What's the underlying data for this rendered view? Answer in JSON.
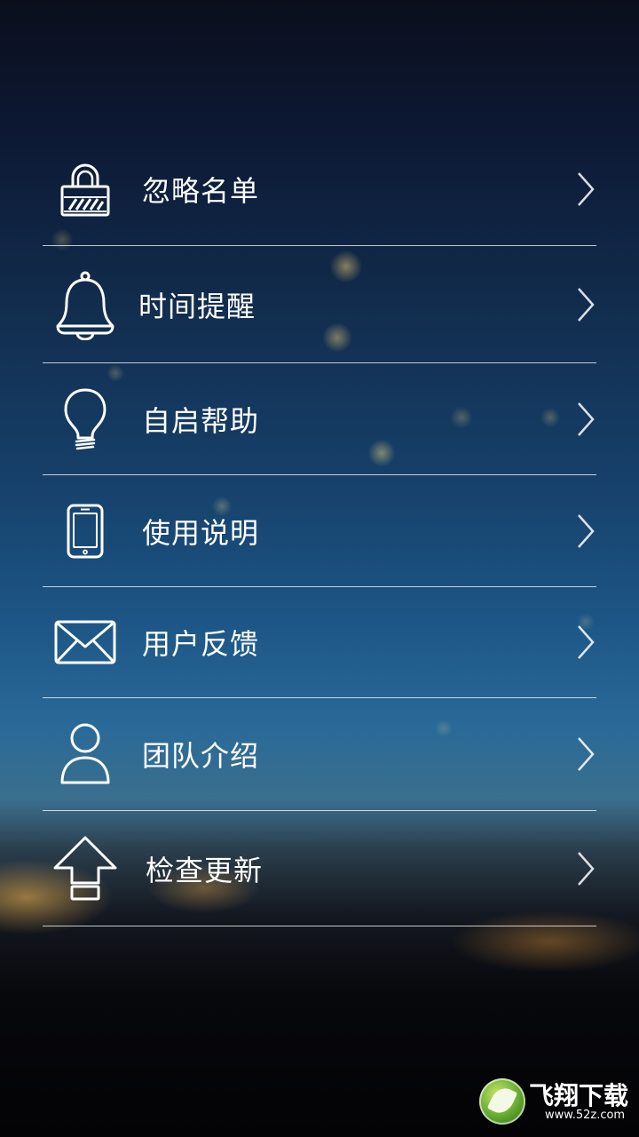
{
  "menu": {
    "items": [
      {
        "label": "忽略名单",
        "icon": "lock-icon"
      },
      {
        "label": "时间提醒",
        "icon": "bell-icon"
      },
      {
        "label": "自启帮助",
        "icon": "lightbulb-icon"
      },
      {
        "label": "使用说明",
        "icon": "smartphone-icon"
      },
      {
        "label": "用户反馈",
        "icon": "envelope-icon"
      },
      {
        "label": "团队介绍",
        "icon": "user-icon"
      },
      {
        "label": "检查更新",
        "icon": "upload-arrow-icon"
      }
    ],
    "chevron_icon": "chevron-right-icon",
    "divider_color": "#ffffff"
  },
  "watermark": {
    "title": "飞翔下载",
    "url": "www.52z.com"
  }
}
